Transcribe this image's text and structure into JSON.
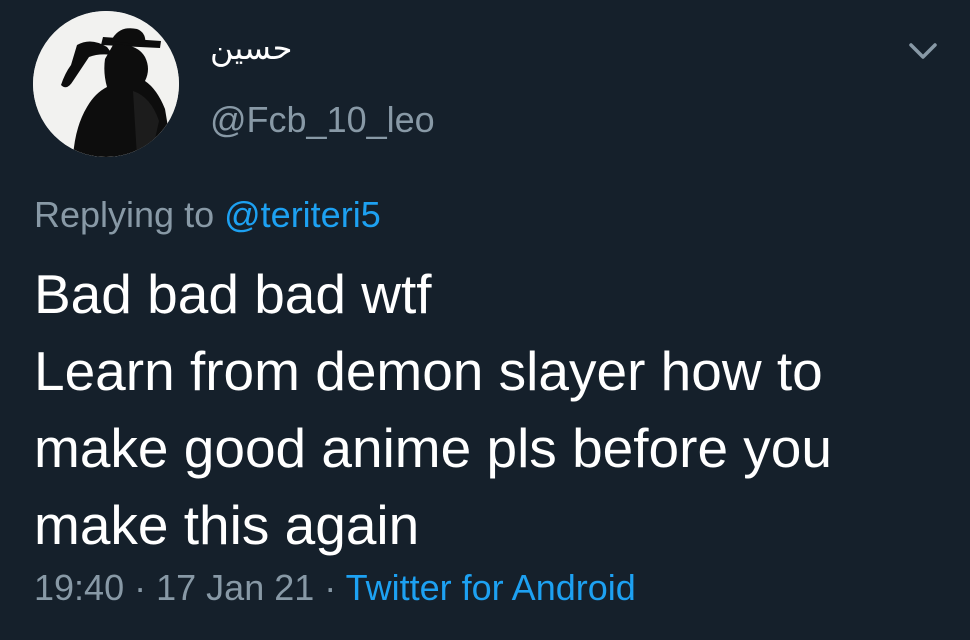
{
  "author": {
    "display_name": "حسين",
    "handle": "@Fcb_10_leo"
  },
  "reply_context": {
    "prefix": "Replying to",
    "mention": "@teriteri5"
  },
  "tweet": {
    "lines": [
      "Bad bad bad wtf",
      "Learn from demon slayer how to",
      "make good anime pls before you",
      "make this again"
    ]
  },
  "meta": {
    "time": "19:40",
    "separator": "·",
    "date": "17 Jan 21",
    "source": "Twitter for Android"
  },
  "icons": {
    "menu": "chevron-down-icon",
    "avatar": "silhouette-avatar"
  },
  "colors": {
    "background": "#15202b",
    "primary_text": "#ffffff",
    "secondary_text": "#8899a6",
    "accent": "#1da1f2"
  }
}
